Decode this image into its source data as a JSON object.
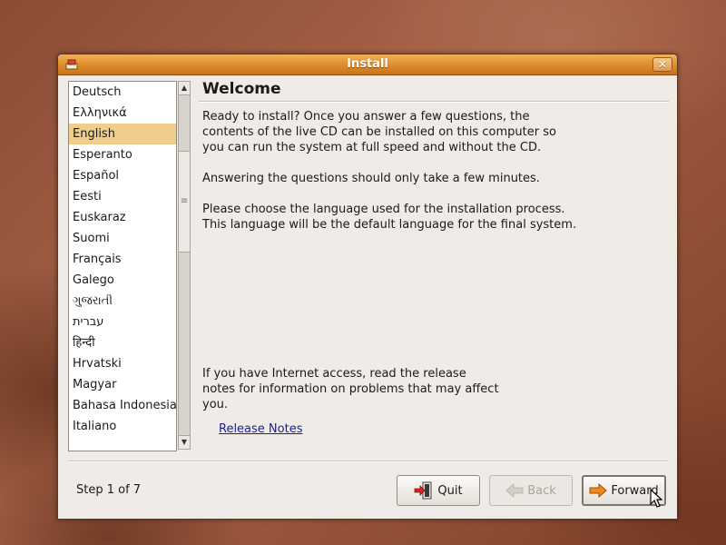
{
  "window": {
    "title": "Install"
  },
  "languages": [
    "Deutsch",
    "Ελληνικά",
    "English",
    "Esperanto",
    "Español",
    "Eesti",
    "Euskaraz",
    "Suomi",
    "Français",
    "Galego",
    "ગુજરાતી",
    "עברית",
    "हिन्दी",
    "Hrvatski",
    "Magyar",
    "Bahasa Indonesia",
    "Italiano"
  ],
  "selected_language": "English",
  "main": {
    "heading": "Welcome",
    "intro_lines": [
      "Ready to install? Once you answer a few questions, the",
      "contents of the live CD can be installed on this computer so",
      "you can run the system at full speed and without the CD."
    ],
    "time_note": "Answering the questions should only take a few minutes.",
    "choose_lines": [
      "Please choose the language used for the installation process.",
      "This language will be the default language for the final system."
    ],
    "internet_lines": [
      "If you have Internet access, read the release",
      "notes for information on problems that may affect",
      "you."
    ],
    "release_notes_link": "Release Notes"
  },
  "footer": {
    "step": "Step 1 of 7",
    "quit_label": "Quit",
    "back_label": "Back",
    "forward_label": "Forward"
  },
  "icons": {
    "title_icon": "installer-icon",
    "close": "close-icon",
    "quit": "quit-icon",
    "back": "back-arrow-icon",
    "forward": "forward-arrow-icon"
  },
  "colors": {
    "titlebar": "#e08e2d",
    "selection": "#f0cd8a",
    "link": "#1a1aa8",
    "window_bg": "#efebe7"
  }
}
